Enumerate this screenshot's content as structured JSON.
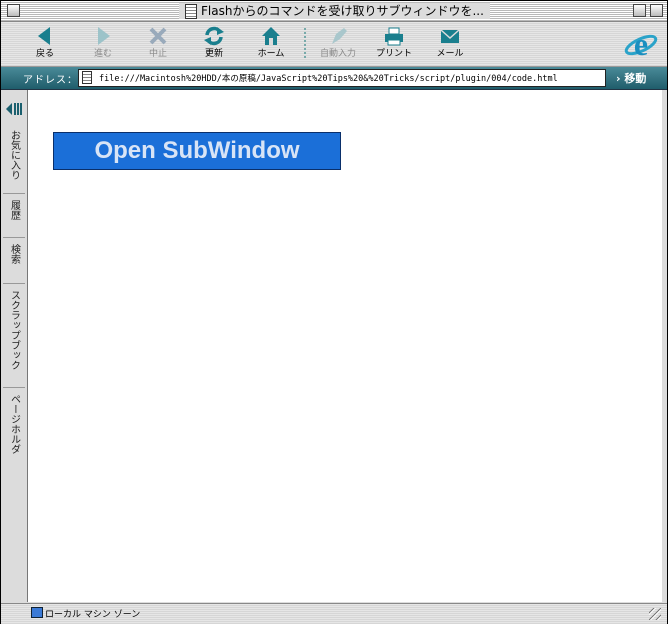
{
  "window": {
    "title": "Flashからのコマンドを受け取りサブウィンドウを..."
  },
  "toolbar": {
    "buttons": [
      {
        "label": "戻る",
        "icon": "back-arrow-icon",
        "enabled": true
      },
      {
        "label": "進む",
        "icon": "forward-arrow-icon",
        "enabled": false
      },
      {
        "label": "中止",
        "icon": "stop-x-icon",
        "enabled": false
      },
      {
        "label": "更新",
        "icon": "refresh-icon",
        "enabled": true
      },
      {
        "label": "ホーム",
        "icon": "home-icon",
        "enabled": true
      },
      {
        "label": "自動入力",
        "icon": "autofill-icon",
        "enabled": false
      },
      {
        "label": "プリント",
        "icon": "printer-icon",
        "enabled": true
      },
      {
        "label": "メール",
        "icon": "mail-icon",
        "enabled": true
      }
    ],
    "brand_icon": "internet-explorer-logo"
  },
  "address": {
    "label": "アドレス：",
    "url": "file:///Macintosh%20HDD/本の原稿/JavaScript%20Tips%20&%20Tricks/script/plugin/004/code.html",
    "go_label": "› 移動"
  },
  "sidebar": {
    "tabs": [
      {
        "label": "お気に入り"
      },
      {
        "label": "履歴"
      },
      {
        "label": "検索"
      },
      {
        "label": "スクラップブック"
      },
      {
        "label": "ページホルダ"
      }
    ]
  },
  "content": {
    "button_label": "Open SubWindow"
  },
  "status": {
    "zone": "ローカル マシン ゾーン"
  },
  "colors": {
    "accent": "#1b6fd8",
    "address_bar": "#2f6f7e",
    "icon_teal": "#1a7f8e"
  }
}
